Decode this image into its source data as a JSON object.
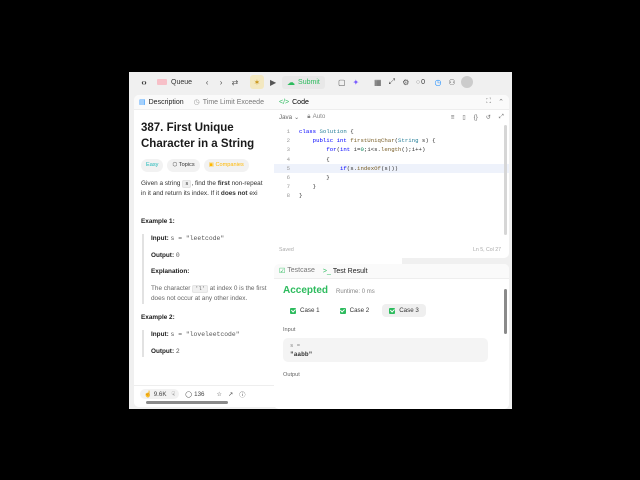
{
  "topbar": {
    "list_label": "Queue",
    "submit_label": "Submit",
    "points": "0"
  },
  "left": {
    "tab_description": "Description",
    "tab_status": "Time Limit Exceede",
    "problem_title": "387. First Unique Character in a String",
    "tags": {
      "difficulty": "Easy",
      "topics": "Topics",
      "companies": "Companies"
    },
    "statement": {
      "p1_a": "Given a string ",
      "p1_code": "s",
      "p1_b": ", find the ",
      "p1_bold": "first",
      "p1_c": " non-repeat",
      "p2_a": "in it and return its index. If it ",
      "p2_bold": "does not",
      "p2_b": " exi"
    },
    "example1": {
      "heading": "Example 1:",
      "input_label": "Input:",
      "input_value": "s = \"leetcode\"",
      "output_label": "Output:",
      "output_value": "0",
      "explanation_label": "Explanation:",
      "expl_a": "The character ",
      "expl_code": "'l'",
      "expl_b": " at index 0 is the first",
      "expl_c": "does not occur at any other index."
    },
    "example2": {
      "heading": "Example 2:",
      "input_label": "Input:",
      "input_value": "s = \"loveleetcode\"",
      "output_label": "Output:",
      "output_value": "2"
    },
    "footer": {
      "likes": "9.6K",
      "comments": "136"
    }
  },
  "code": {
    "title": "Code",
    "language": "Java",
    "mode": "Auto",
    "lines": [
      "1",
      "2",
      "3",
      "4",
      "5",
      "6",
      "7",
      "8"
    ],
    "status_saved": "Saved",
    "cursor_pos": "Ln 5, Col 27"
  },
  "result": {
    "tab_testcase": "Testcase",
    "tab_result": "Test Result",
    "verdict": "Accepted",
    "runtime": "Runtime: 0 ms",
    "cases": [
      "Case 1",
      "Case 2",
      "Case 3"
    ],
    "input_heading": "Input",
    "var_name": "s =",
    "var_value": "\"aabb\"",
    "output_heading": "Output"
  },
  "colors": {
    "accent_green": "#2cbb5d",
    "easy": "#1cb8b8",
    "companies": "#ffb800"
  }
}
